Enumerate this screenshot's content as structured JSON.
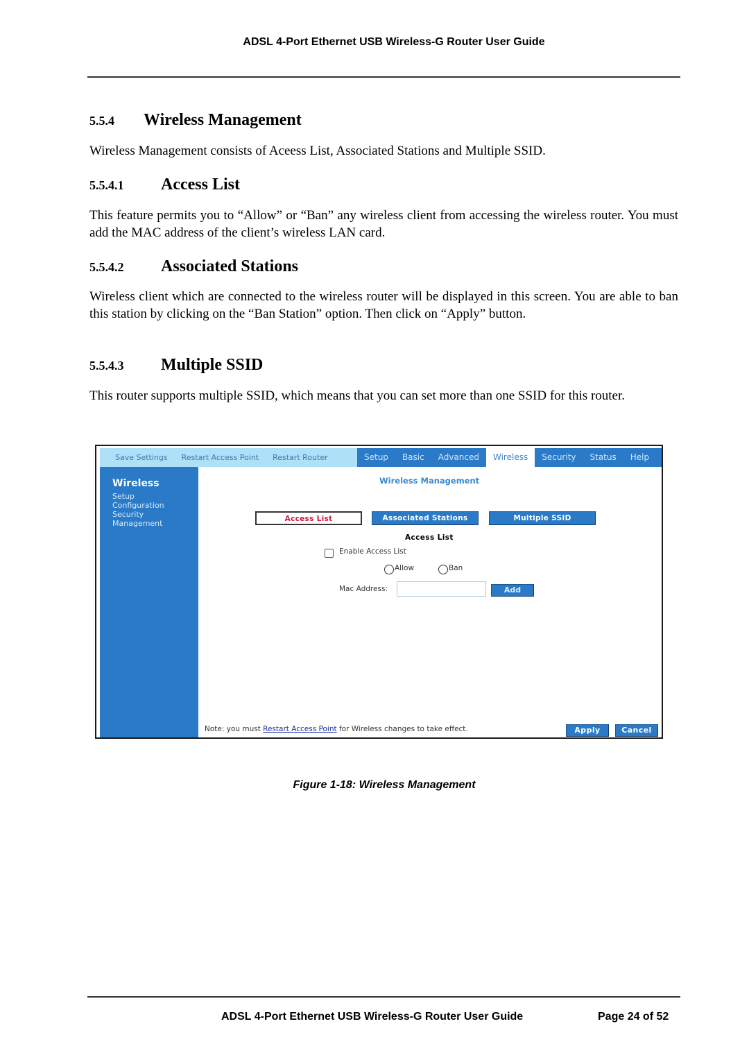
{
  "header": {
    "title": "ADSL 4-Port Ethernet USB Wireless-G Router User Guide"
  },
  "sections": {
    "main": {
      "number": "5.5.4",
      "title": "Wireless Management",
      "body": "Wireless Management consists of Aceess List, Associated Stations and Multiple SSID."
    },
    "access_list": {
      "number": "5.5.4.1",
      "title": "Access List",
      "body": "This feature permits you to “Allow” or “Ban” any wireless client from accessing the wireless router. You must add the MAC address of the client’s wireless LAN card."
    },
    "associated_stations": {
      "number": "5.5.4.2",
      "title": "Associated Stations",
      "body": "Wireless client which are connected to the wireless router will be displayed in this screen. You are able to ban this station by clicking on the “Ban Station” option. Then click on “Apply” button."
    },
    "multiple_ssid": {
      "number": "5.5.4.3",
      "title": "Multiple SSID",
      "body": "This router supports multiple SSID, which means that you can set more than one SSID for this router."
    }
  },
  "figure": {
    "utility_links": [
      "Save Settings",
      "Restart Access Point",
      "Restart Router"
    ],
    "main_tabs": [
      {
        "label": "Setup",
        "active": false
      },
      {
        "label": "Basic",
        "active": false
      },
      {
        "label": "Advanced",
        "active": false
      },
      {
        "label": "Wireless",
        "active": true
      },
      {
        "label": "Security",
        "active": false
      },
      {
        "label": "Status",
        "active": false
      },
      {
        "label": "Help",
        "active": false
      }
    ],
    "sidebar": {
      "title": "Wireless",
      "items": [
        "Setup",
        "Configuration",
        "Security",
        "Management"
      ]
    },
    "content_title": "Wireless Management",
    "subtabs": {
      "access_list": "Access List",
      "associated_stations": "Associated Stations",
      "multiple_ssid": "Multiple SSID"
    },
    "form": {
      "section_label": "Access List",
      "enable_label": "Enable Access List",
      "enable_checked": false,
      "radio_allow": "Allow",
      "radio_ban": "Ban",
      "mac_label": "Mac Address:",
      "mac_value": "",
      "add_button": "Add"
    },
    "note": {
      "prefix": "Note: you must ",
      "link": "Restart Access Point",
      "suffix": " for Wireless changes to take effect."
    },
    "buttons": {
      "apply": "Apply",
      "cancel": "Cancel"
    },
    "colors": {
      "nav_blue": "#2a7ac8",
      "topbar_light_blue": "#aee0f7",
      "active_subtab_red": "#d0183c",
      "title_blue": "#3a8ad2"
    }
  },
  "caption": "Figure 1-18: Wireless Management",
  "footer": {
    "title": "ADSL 4-Port Ethernet USB Wireless-G Router User Guide",
    "page": "Page 24 of 52"
  }
}
